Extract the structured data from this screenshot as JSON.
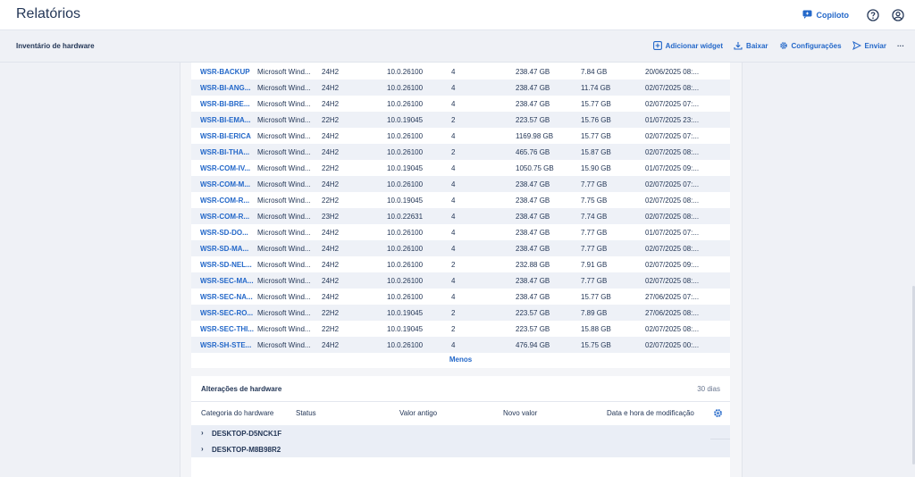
{
  "header": {
    "title": "Relatórios",
    "copilot_label": "Copiloto"
  },
  "subheader": {
    "title": "Inventário de hardware",
    "actions": {
      "add_widget": "Adicionar widget",
      "download": "Baixar",
      "settings": "Configurações",
      "send": "Enviar",
      "more": "···"
    }
  },
  "inventory": {
    "rows": [
      {
        "name": "WSR-BACKUP",
        "os": "Microsoft Wind...",
        "version": "24H2",
        "build": "10.0.26100",
        "cores": "4",
        "disk": "238.47 GB",
        "ram": "7.84 GB",
        "date": "20/06/2025 08:..."
      },
      {
        "name": "WSR-BI-ANG...",
        "os": "Microsoft Wind...",
        "version": "24H2",
        "build": "10.0.26100",
        "cores": "4",
        "disk": "238.47 GB",
        "ram": "11.74 GB",
        "date": "02/07/2025 08:..."
      },
      {
        "name": "WSR-BI-BRE...",
        "os": "Microsoft Wind...",
        "version": "24H2",
        "build": "10.0.26100",
        "cores": "4",
        "disk": "238.47 GB",
        "ram": "15.77 GB",
        "date": "02/07/2025 07:..."
      },
      {
        "name": "WSR-BI-EMA...",
        "os": "Microsoft Wind...",
        "version": "22H2",
        "build": "10.0.19045",
        "cores": "2",
        "disk": "223.57 GB",
        "ram": "15.76 GB",
        "date": "01/07/2025 23:..."
      },
      {
        "name": "WSR-BI-ERICA",
        "os": "Microsoft Wind...",
        "version": "24H2",
        "build": "10.0.26100",
        "cores": "4",
        "disk": "1169.98 GB",
        "ram": "15.77 GB",
        "date": "02/07/2025 07:..."
      },
      {
        "name": "WSR-BI-THA...",
        "os": "Microsoft Wind...",
        "version": "24H2",
        "build": "10.0.26100",
        "cores": "2",
        "disk": "465.76 GB",
        "ram": "15.87 GB",
        "date": "02/07/2025 08:..."
      },
      {
        "name": "WSR-COM-IV...",
        "os": "Microsoft Wind...",
        "version": "22H2",
        "build": "10.0.19045",
        "cores": "4",
        "disk": "1050.75 GB",
        "ram": "15.90 GB",
        "date": "01/07/2025 09:..."
      },
      {
        "name": "WSR-COM-M...",
        "os": "Microsoft Wind...",
        "version": "24H2",
        "build": "10.0.26100",
        "cores": "4",
        "disk": "238.47 GB",
        "ram": "7.77 GB",
        "date": "02/07/2025 07:..."
      },
      {
        "name": "WSR-COM-R...",
        "os": "Microsoft Wind...",
        "version": "22H2",
        "build": "10.0.19045",
        "cores": "4",
        "disk": "238.47 GB",
        "ram": "7.75 GB",
        "date": "02/07/2025 08:..."
      },
      {
        "name": "WSR-COM-R...",
        "os": "Microsoft Wind...",
        "version": "23H2",
        "build": "10.0.22631",
        "cores": "4",
        "disk": "238.47 GB",
        "ram": "7.74 GB",
        "date": "02/07/2025 08:..."
      },
      {
        "name": "WSR-SD-DO...",
        "os": "Microsoft Wind...",
        "version": "24H2",
        "build": "10.0.26100",
        "cores": "4",
        "disk": "238.47 GB",
        "ram": "7.77 GB",
        "date": "01/07/2025 07:..."
      },
      {
        "name": "WSR-SD-MA...",
        "os": "Microsoft Wind...",
        "version": "24H2",
        "build": "10.0.26100",
        "cores": "4",
        "disk": "238.47 GB",
        "ram": "7.77 GB",
        "date": "02/07/2025 08:..."
      },
      {
        "name": "WSR-SD-NEL...",
        "os": "Microsoft Wind...",
        "version": "24H2",
        "build": "10.0.26100",
        "cores": "2",
        "disk": "232.88 GB",
        "ram": "7.91 GB",
        "date": "02/07/2025 09:..."
      },
      {
        "name": "WSR-SEC-MA...",
        "os": "Microsoft Wind...",
        "version": "24H2",
        "build": "10.0.26100",
        "cores": "4",
        "disk": "238.47 GB",
        "ram": "7.77 GB",
        "date": "02/07/2025 08:..."
      },
      {
        "name": "WSR-SEC-NA...",
        "os": "Microsoft Wind...",
        "version": "24H2",
        "build": "10.0.26100",
        "cores": "4",
        "disk": "238.47 GB",
        "ram": "15.77 GB",
        "date": "27/06/2025 07:..."
      },
      {
        "name": "WSR-SEC-RO...",
        "os": "Microsoft Wind...",
        "version": "22H2",
        "build": "10.0.19045",
        "cores": "2",
        "disk": "223.57 GB",
        "ram": "7.89 GB",
        "date": "27/06/2025 08:..."
      },
      {
        "name": "WSR-SEC-THI...",
        "os": "Microsoft Wind...",
        "version": "22H2",
        "build": "10.0.19045",
        "cores": "2",
        "disk": "223.57 GB",
        "ram": "15.88 GB",
        "date": "02/07/2025 08:..."
      },
      {
        "name": "WSR-SH-STE...",
        "os": "Microsoft Wind...",
        "version": "24H2",
        "build": "10.0.26100",
        "cores": "4",
        "disk": "476.94 GB",
        "ram": "15.75 GB",
        "date": "02/07/2025 00:..."
      }
    ],
    "less_label": "Menos"
  },
  "hardware_changes": {
    "title": "Alterações de hardware",
    "period": "30 dias",
    "columns": {
      "category": "Categoria do hardware",
      "status": "Status",
      "old_value": "Valor antigo",
      "new_value": "Novo valor",
      "datetime": "Data e hora de modificação"
    },
    "groups": [
      {
        "label": "DESKTOP-D5NCK1F"
      },
      {
        "label": "DESKTOP-M8B98R2"
      }
    ]
  },
  "colors": {
    "accent": "#2468c9",
    "text": "#243757",
    "row_alt": "#eef1f7",
    "background": "#eff1f6"
  }
}
